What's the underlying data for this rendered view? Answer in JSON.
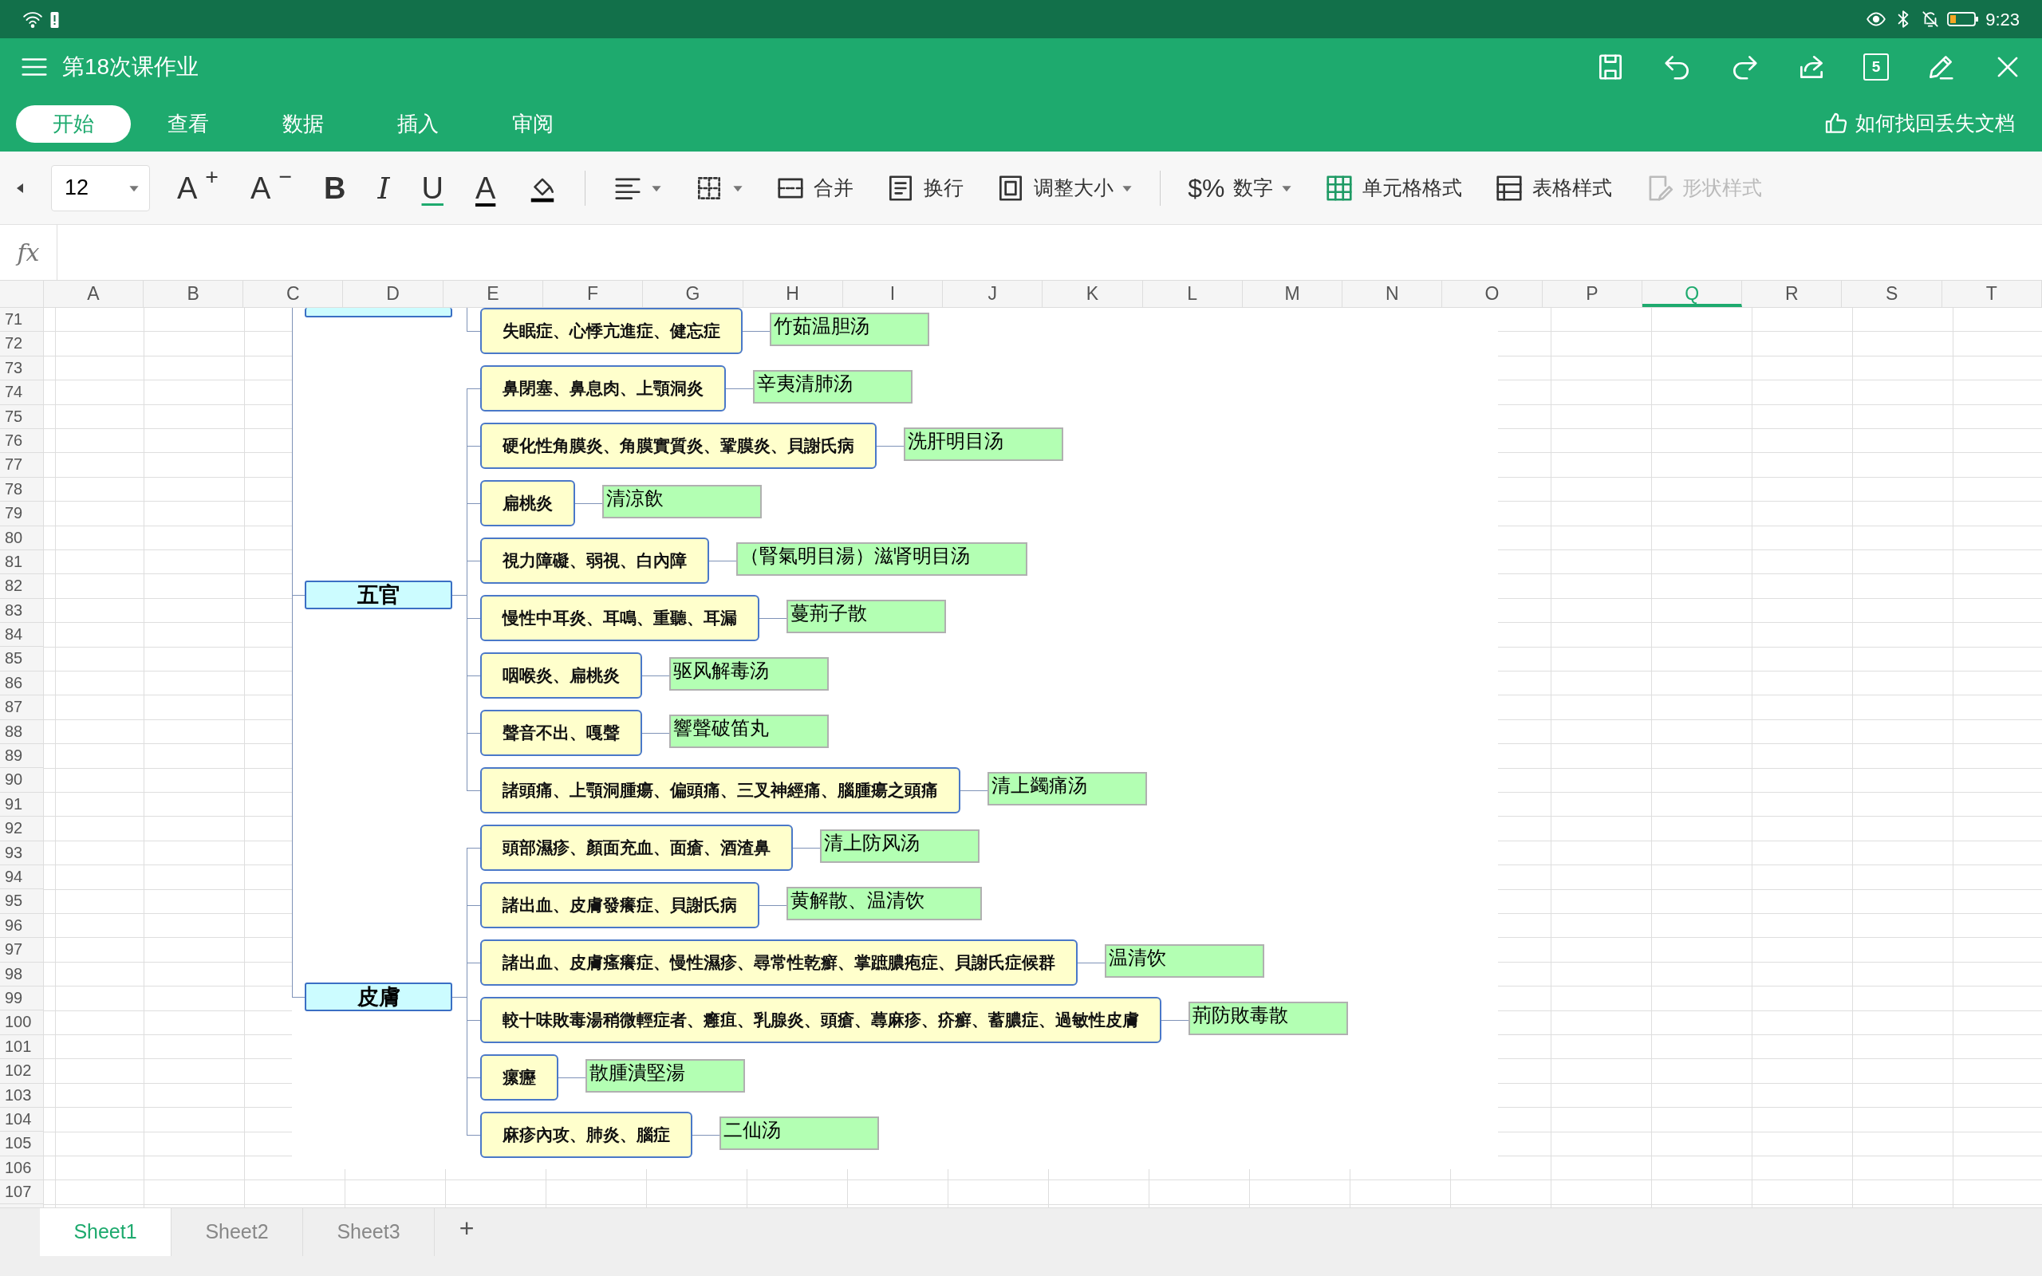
{
  "status_bar": {
    "time": "9:23"
  },
  "title_bar": {
    "title": "第18次课作业",
    "actions": [
      {
        "kind": "save"
      },
      {
        "kind": "undo"
      },
      {
        "kind": "redo"
      },
      {
        "kind": "share"
      },
      {
        "kind": "pages",
        "text": "5"
      },
      {
        "kind": "edit"
      },
      {
        "kind": "close"
      }
    ]
  },
  "tabs": [
    {
      "label": "开始",
      "selected": true
    },
    {
      "label": "查看",
      "selected": false
    },
    {
      "label": "数据",
      "selected": false
    },
    {
      "label": "插入",
      "selected": false
    },
    {
      "label": "审阅",
      "selected": false
    }
  ],
  "help_link": "如何找回丢失文档",
  "toolbar": [
    {
      "kind": "arrow"
    },
    {
      "kind": "select",
      "value": "12"
    },
    {
      "kind": "grow",
      "text": "A$^{+}$"
    },
    {
      "kind": "shrink",
      "text": "A$^{−}$"
    },
    {
      "kind": "bold",
      "text": "B"
    },
    {
      "kind": "italic",
      "text": "I"
    },
    {
      "kind": "underline",
      "text": "U"
    },
    {
      "kind": "color",
      "text": "A"
    },
    {
      "kind": "fill",
      "dropdown": false
    },
    {
      "kind": "separator"
    },
    {
      "kind": "align",
      "dropdown": true
    },
    {
      "kind": "borders",
      "dropdown": true
    },
    {
      "kind": "merge",
      "label": "合并",
      "dropdown": false,
      "disabled": false
    },
    {
      "kind": "wrap",
      "label": "换行",
      "dropdown": false,
      "disabled": false
    },
    {
      "kind": "resize",
      "label": "调整大小",
      "dropdown": true,
      "disabled": false
    },
    {
      "kind": "separator"
    },
    {
      "kind": "number",
      "glyph": "$%",
      "label": "数字",
      "dropdown": true,
      "disabled": false
    },
    {
      "kind": "grid",
      "label": "单元格格式",
      "dropdown": false,
      "disabled": false
    },
    {
      "kind": "table",
      "label": "表格样式",
      "dropdown": false,
      "disabled": false
    },
    {
      "kind": "shape",
      "label": "形状样式",
      "dropdown": false,
      "disabled": true
    }
  ],
  "formula_bar": {
    "label": "fx"
  },
  "columns": [
    {
      "label": "A",
      "selected": false
    },
    {
      "label": "B",
      "selected": false
    },
    {
      "label": "C",
      "selected": false
    },
    {
      "label": "D",
      "selected": false
    },
    {
      "label": "E",
      "selected": false
    },
    {
      "label": "F",
      "selected": false
    },
    {
      "label": "G",
      "selected": false
    },
    {
      "label": "H",
      "selected": false
    },
    {
      "label": "I",
      "selected": false
    },
    {
      "label": "J",
      "selected": false
    },
    {
      "label": "K",
      "selected": false
    },
    {
      "label": "L",
      "selected": false
    },
    {
      "label": "M",
      "selected": false
    },
    {
      "label": "N",
      "selected": false
    },
    {
      "label": "O",
      "selected": false
    },
    {
      "label": "P",
      "selected": false
    },
    {
      "label": "Q",
      "selected": true
    },
    {
      "label": "R",
      "selected": false
    },
    {
      "label": "S",
      "selected": false
    },
    {
      "label": "T",
      "selected": false
    }
  ],
  "rows": [
    "71",
    "72",
    "73",
    "74",
    "75",
    "76",
    "77",
    "78",
    "79",
    "80",
    "81",
    "82",
    "83",
    "84",
    "85",
    "86",
    "87",
    "88",
    "89",
    "90",
    "91",
    "92",
    "93",
    "94",
    "95",
    "96",
    "97",
    "98",
    "99",
    "100",
    "101",
    "102",
    "103",
    "104",
    "105",
    "106",
    "107"
  ],
  "mindmap": {
    "groups": [
      {
        "category": {
          "cut": true
        },
        "items": [
          {
            "symptom": "失眠症、心悸亢進症、健忘症",
            "remedy": "竹茹温胆汤"
          }
        ]
      },
      {
        "category": {
          "cut": false,
          "label": "五官"
        },
        "items": [
          {
            "symptom": "鼻閉塞、鼻息肉、上顎洞炎",
            "remedy": "辛夷清肺汤"
          },
          {
            "symptom": "硬化性角膜炎、角膜實質炎、鞏膜炎、貝謝氏病",
            "remedy": "洗肝明目汤"
          },
          {
            "symptom": "扁桃炎",
            "remedy": "清涼飲"
          },
          {
            "symptom": "視力障礙、弱視、白內障",
            "remedy": "（腎氣明目湯）滋肾明目汤"
          },
          {
            "symptom": "慢性中耳炎、耳鳴、重聽、耳漏",
            "remedy": "蔓荊子散"
          },
          {
            "symptom": "咽喉炎、扁桃炎",
            "remedy": "驱风解毒汤"
          },
          {
            "symptom": "聲音不出、嘎聲",
            "remedy": "響聲破笛丸"
          },
          {
            "symptom": "諸頭痛、上顎洞腫瘍、偏頭痛、三叉神經痛、腦腫瘍之頭痛",
            "remedy": "清上蠲痛汤"
          }
        ]
      },
      {
        "category": {
          "cut": false,
          "label": "皮膚"
        },
        "items": [
          {
            "symptom": "頭部濕疹、顏面充血、面瘡、酒渣鼻",
            "remedy": "清上防风汤"
          },
          {
            "symptom": "諸出血、皮膚發癢症、貝謝氏病",
            "remedy": "黄解散、温清饮"
          },
          {
            "symptom": "諸出血、皮膚瘙癢症、慢性濕疹、尋常性乾癬、掌蹠膿疱症、貝謝氏症候群",
            "remedy": "温清饮"
          },
          {
            "symptom": "較十味敗毒湯稍微輕症者、癰疽、乳腺炎、頭瘡、蕁麻疹、疥癬、蓄膿症、過敏性皮膚",
            "remedy": "荊防敗毒散"
          },
          {
            "symptom": "瘰癧",
            "remedy": "散腫潰堅湯"
          },
          {
            "symptom": "麻疹內攻、肺炎、腦症",
            "remedy": "二仙汤"
          }
        ]
      }
    ]
  },
  "sheets": [
    {
      "label": "Sheet1",
      "selected": true
    },
    {
      "label": "Sheet2",
      "selected": false
    },
    {
      "label": "Sheet3",
      "selected": false
    }
  ],
  "add_sheet": "+"
}
